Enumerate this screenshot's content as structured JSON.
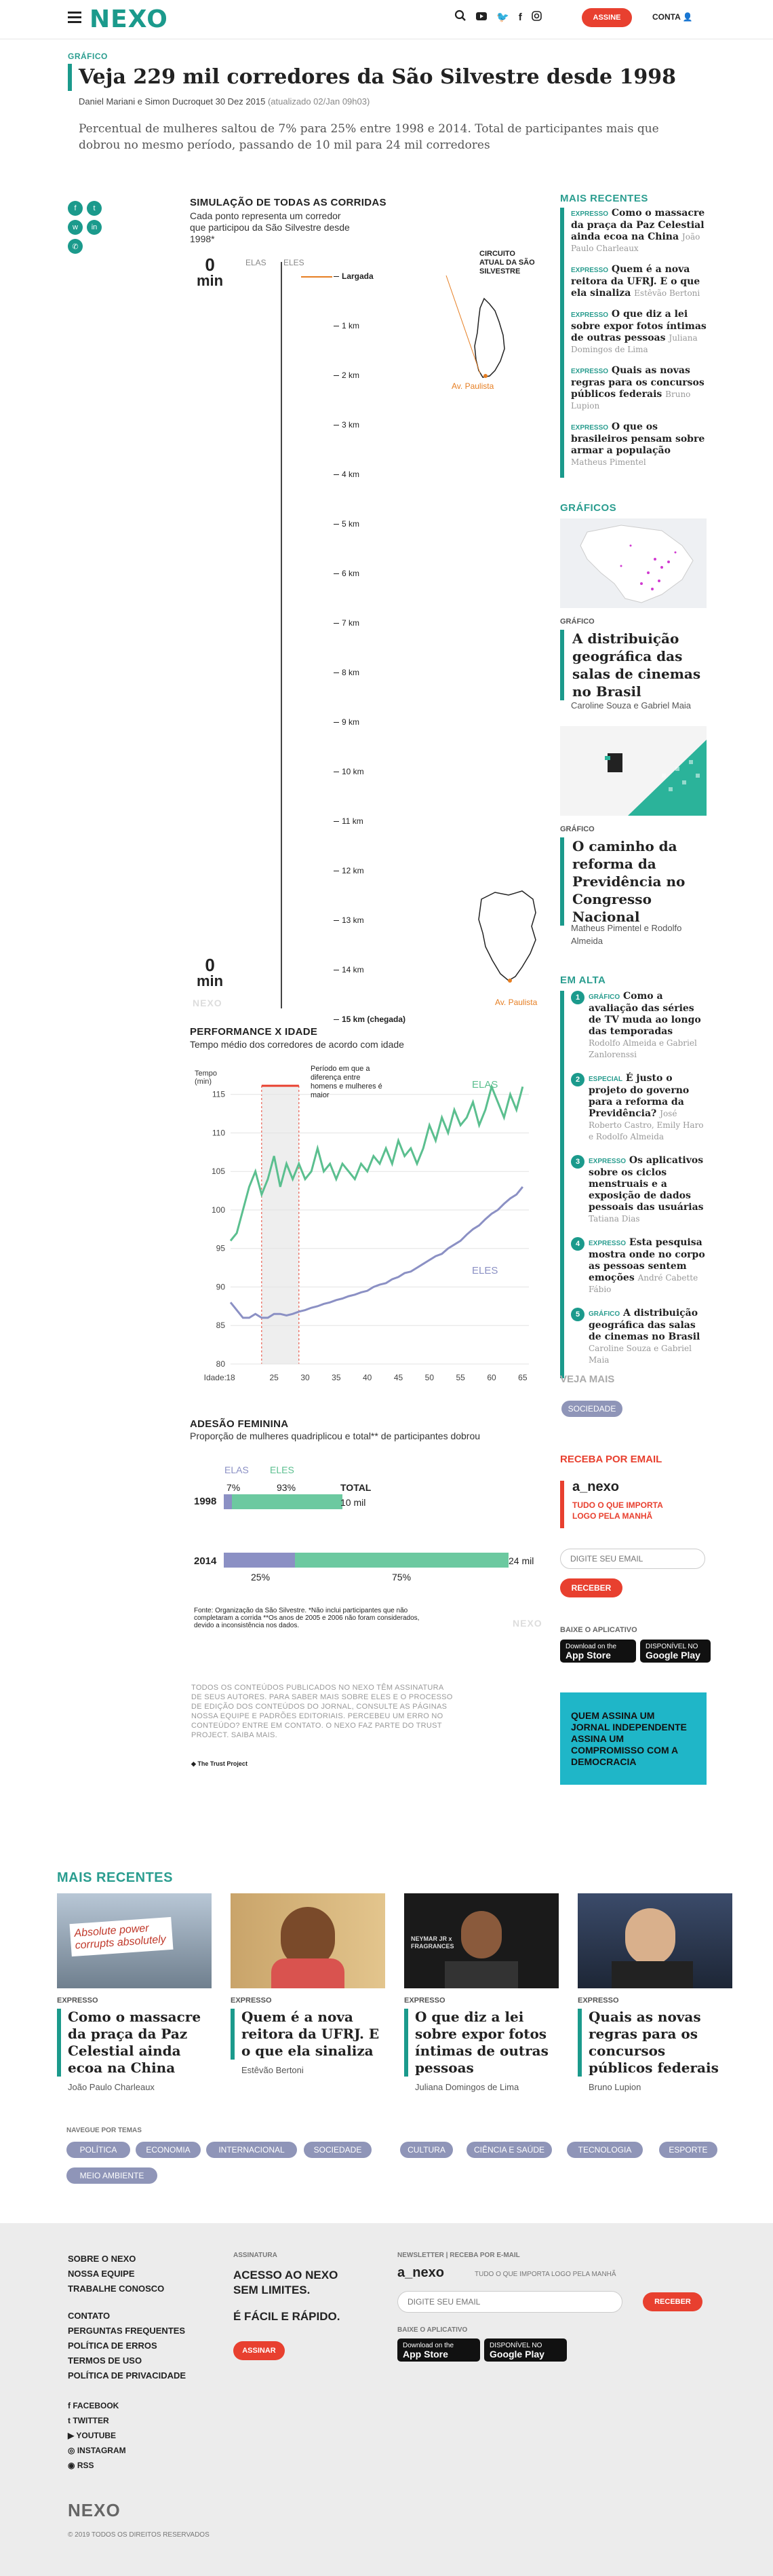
{
  "header": {
    "logo": "NEXO",
    "subscribe_label": "ASSINE",
    "account_label": "CONTA"
  },
  "article": {
    "kicker": "GRÁFICO",
    "title": "Veja 229 mil corredores da São Silvestre desde 1998",
    "authors": "Daniel Mariani e Simon Ducroquet",
    "date": "30 Dez 2015",
    "updated": "(atualizado 02/Jan 09h03)",
    "lead": "Percentual de mulheres saltou de 7% para 25% entre 1998 e 2014. Total de participantes mais que dobrou no mesmo período, passando de 10 mil para 24 mil corredores"
  },
  "simulation": {
    "title": "SIMULAÇÃO DE TODAS AS CORRIDAS",
    "subtitle": "Cada ponto representa um corredor que participou da São Silvestre desde 1998*",
    "time_top": "0",
    "time_top_unit": "min",
    "time_bottom": "0",
    "time_bottom_unit": "min",
    "elas": "ELAS",
    "eles": "ELES",
    "watermark": "NEXO",
    "km_labels": [
      "Largada",
      "1 km",
      "2 km",
      "3 km",
      "4 km",
      "5 km",
      "6 km",
      "7 km",
      "8 km",
      "9 km",
      "10 km",
      "11 km",
      "12 km",
      "13 km",
      "14 km",
      "15 km (chegada)"
    ],
    "circuit_label": "CIRCUITO ATUAL DA SÃO SILVESTRE",
    "paulista_label": "Av. Paulista",
    "paulista_label_2": "Av. Paulista"
  },
  "performance": {
    "title": "PERFORMANCE X IDADE",
    "subtitle": "Tempo médio dos corredores de acordo com idade",
    "ylabel": "Tempo (min)",
    "xlabel": "Idade:",
    "annotation": "Período em que a diferença entre homens e mulheres é maior",
    "elas": "ELAS",
    "eles": "ELES"
  },
  "chart_data": {
    "type": "line",
    "title": "PERFORMANCE X IDADE",
    "ylabel": "Tempo (min)",
    "xlabel": "Idade:",
    "x_ticks": [
      18,
      25,
      30,
      35,
      40,
      45,
      50,
      55,
      60,
      65
    ],
    "y_ticks": [
      80,
      85,
      90,
      95,
      100,
      105,
      110,
      115
    ],
    "ylim": [
      80,
      117
    ],
    "xlim": [
      18,
      66
    ],
    "highlight_range": [
      23,
      29
    ],
    "series": [
      {
        "name": "ELAS",
        "color": "#5bbf8f",
        "x": [
          18,
          19,
          20,
          21,
          22,
          23,
          24,
          25,
          26,
          27,
          28,
          29,
          30,
          31,
          32,
          33,
          34,
          35,
          36,
          37,
          38,
          39,
          40,
          41,
          42,
          43,
          44,
          45,
          46,
          47,
          48,
          49,
          50,
          51,
          52,
          53,
          54,
          55,
          56,
          57,
          58,
          59,
          60,
          61,
          62,
          63,
          64,
          65
        ],
        "values": [
          96,
          97,
          100,
          103,
          105,
          102,
          104,
          107,
          103,
          106,
          104,
          106,
          104,
          105,
          108,
          105,
          106,
          104,
          106,
          105,
          104,
          106,
          105,
          107,
          106,
          108,
          106,
          109,
          107,
          108,
          106,
          108,
          111,
          109,
          112,
          110,
          113,
          111,
          112,
          114,
          111,
          113,
          116,
          114,
          112,
          115,
          113,
          116
        ]
      },
      {
        "name": "ELES",
        "color": "#8b90c4",
        "x": [
          18,
          19,
          20,
          21,
          22,
          23,
          24,
          25,
          26,
          27,
          28,
          29,
          30,
          31,
          32,
          33,
          34,
          35,
          36,
          37,
          38,
          39,
          40,
          41,
          42,
          43,
          44,
          45,
          46,
          47,
          48,
          49,
          50,
          51,
          52,
          53,
          54,
          55,
          56,
          57,
          58,
          59,
          60,
          61,
          62,
          63,
          64,
          65
        ],
        "values": [
          88,
          87,
          86,
          86,
          86.5,
          86,
          86,
          86.5,
          86.5,
          86.3,
          86.5,
          86.8,
          87,
          87.3,
          87.5,
          87.8,
          88,
          88.3,
          88.5,
          88.8,
          89,
          89.3,
          89.5,
          90,
          90.3,
          90.5,
          91,
          91.3,
          91.8,
          92,
          92.5,
          93,
          93.5,
          94,
          94.3,
          95,
          95.5,
          96,
          96.8,
          97.5,
          98,
          98.8,
          99.5,
          100,
          100.8,
          101.5,
          102,
          103
        ]
      }
    ]
  },
  "adesao": {
    "title": "ADESÃO FEMININA",
    "subtitle": "Proporção de mulheres quadriplicou e total** de participantes dobrou",
    "elas": "ELAS",
    "eles": "ELES",
    "total": "TOTAL",
    "rows": [
      {
        "year": "1998",
        "women_pct": "7%",
        "men_pct": "93%",
        "total": "10 mil",
        "women": 0.07,
        "total_k": 10
      },
      {
        "year": "2014",
        "women_pct": "25%",
        "men_pct": "75%",
        "total": "24 mil",
        "women": 0.25,
        "total_k": 24
      }
    ],
    "source": "Fonte: Organização da São Silvestre. *Não inclui participantes que não completaram a corrida **Os anos de 2005 e 2006 não foram considerados, devido a inconsistência nos dados.",
    "watermark": "NEXO"
  },
  "disclaimer": {
    "text": "TODOS OS CONTEÚDOS PUBLICADOS NO NEXO TÊM ASSINATURA DE SEUS AUTORES. PARA SABER MAIS SOBRE ELES E O PROCESSO DE EDIÇÃO DOS CONTEÚDOS DO JORNAL, CONSULTE AS PÁGINAS NOSSA EQUIPE E PADRÕES EDITORIAIS. PERCEBEU UM ERRO NO CONTEÚDO? ENTRE EM CONTATO. O NEXO FAZ PARTE DO TRUST PROJECT. SAIBA MAIS.",
    "trust": "The Trust Project"
  },
  "sidebar": {
    "recent_title": "MAIS RECENTES",
    "recent": [
      {
        "tag": "EXPRESSO",
        "title": "Como o massacre da praça da Paz Celestial ainda ecoa na China",
        "author": "João Paulo Charleaux"
      },
      {
        "tag": "EXPRESSO",
        "title": "Quem é a nova reitora da UFRJ. E o que ela sinaliza",
        "author": "Estêvão Bertoni"
      },
      {
        "tag": "EXPRESSO",
        "title": "O que diz a lei sobre expor fotos íntimas de outras pessoas",
        "author": "Juliana Domingos de Lima"
      },
      {
        "tag": "EXPRESSO",
        "title": "Quais as novas regras para os concursos públicos federais",
        "author": "Bruno Lupion"
      },
      {
        "tag": "EXPRESSO",
        "title": "O que os brasileiros pensam sobre armar a população",
        "author": "Matheus Pimentel"
      }
    ],
    "graphics_title": "GRÁFICOS",
    "graphics": [
      {
        "label": "GRÁFICO",
        "title": "A distribuição geográfica das salas de cinemas no Brasil",
        "author": "Caroline Souza e Gabriel Maia"
      },
      {
        "label": "GRÁFICO",
        "title": "O caminho da reforma da Previdência no Congresso Nacional",
        "author": "Matheus Pimentel e Rodolfo Almeida"
      }
    ],
    "trending_title": "EM ALTA",
    "trending": [
      {
        "n": "1",
        "tag": "GRÁFICO",
        "title": "Como a avaliação das séries de TV muda ao longo das temporadas",
        "author": "Rodolfo Almeida e Gabriel Zanlorenssi"
      },
      {
        "n": "2",
        "tag": "ESPECIAL",
        "title": "É justo o projeto do governo para a reforma da Previdência?",
        "author": "José Roberto Castro, Emily Haro e Rodolfo Almeida"
      },
      {
        "n": "3",
        "tag": "EXPRESSO",
        "title": "Os aplicativos sobre os ciclos menstruais e a exposição de dados pessoais das usuárias",
        "author": "Tatiana Dias"
      },
      {
        "n": "4",
        "tag": "EXPRESSO",
        "title": "Esta pesquisa mostra onde no corpo as pessoas sentem emoções",
        "author": "André Cabette Fábio"
      },
      {
        "n": "5",
        "tag": "GRÁFICO",
        "title": "A distribuição geográfica das salas de cinemas no Brasil",
        "author": "Caroline Souza e Gabriel Maia"
      }
    ],
    "see_more_title": "VEJA MAIS",
    "see_more_tag": "SOCIEDADE",
    "newsletter_title": "RECEBA POR EMAIL",
    "newsletter_name": "a_nexo",
    "newsletter_desc": "TUDO O QUE IMPORTA LOGO PELA MANHÃ",
    "email_placeholder": "DIGITE SEU EMAIL",
    "receive_label": "RECEBER",
    "app_title": "BAIXE O APLICATIVO",
    "app_store": "App Store",
    "app_store_small": "Download on the",
    "google_play": "Google Play",
    "google_play_small": "DISPONÍVEL NO",
    "promo": "QUEM ASSINA UM JORNAL INDEPENDENTE ASSINA UM COMPROMISSO COM A DEMOCRACIA"
  },
  "bottom_recent": {
    "title": "MAIS RECENTES",
    "items": [
      {
        "tag": "EXPRESSO",
        "title": "Como o massacre da praça da Paz Celestial ainda ecoa na China",
        "author": "João Paulo Charleaux",
        "img_text": "Absolute power corrupts absolutely"
      },
      {
        "tag": "EXPRESSO",
        "title": "Quem é a nova reitora da UFRJ. E o que ela sinaliza",
        "author": "Estêvão Bertoni"
      },
      {
        "tag": "EXPRESSO",
        "title": "O que diz a lei sobre expor fotos íntimas de outras pessoas",
        "author": "Juliana Domingos de Lima",
        "img_text": "NEYMAR JR x FRAGRANCES"
      },
      {
        "tag": "EXPRESSO",
        "title": "Quais as novas regras para os concursos públicos federais",
        "author": "Bruno Lupion"
      }
    ]
  },
  "topics": {
    "title": "NAVEGUE POR TEMAS",
    "items": [
      "POLÍTICA",
      "ECONOMIA",
      "INTERNACIONAL",
      "SOCIEDADE",
      "CULTURA",
      "CIÊNCIA E SAÚDE",
      "TECNOLOGIA",
      "ESPORTE",
      "MEIO AMBIENTE"
    ]
  },
  "footer": {
    "links1": [
      "SOBRE O NEXO",
      "NOSSA EQUIPE",
      "TRABALHE CONOSCO"
    ],
    "links2": [
      "CONTATO",
      "PERGUNTAS FREQUENTES",
      "POLÍTICA DE ERROS",
      "TERMOS DE USO",
      "POLÍTICA DE PRIVACIDADE"
    ],
    "social": [
      "FACEBOOK",
      "TWITTER",
      "YOUTUBE",
      "INSTAGRAM",
      "RSS"
    ],
    "sign_label": "ASSINATURA",
    "sign_line1": "ACESSO AO NEXO",
    "sign_line2": "SEM LIMITES.",
    "sign_line3": "É FÁCIL E RÁPIDO.",
    "sign_button": "ASSINAR",
    "nl_label": "NEWSLETTER | RECEBA POR E-MAIL",
    "nl_name": "a_nexo",
    "nl_desc": "TUDO O QUE IMPORTA LOGO PELA MANHÃ",
    "email_placeholder": "DIGITE SEU EMAIL",
    "receive_label": "RECEBER",
    "app_label": "BAIXE O APLICATIVO",
    "app_store": "App Store",
    "app_store_small": "Download on the",
    "google_play": "Google Play",
    "google_play_small": "DISPONÍVEL NO",
    "logo": "NEXO",
    "copyright": "© 2019 TODOS OS DIREITOS RESERVADOS"
  },
  "colors": {
    "brand": "#1b9a8c",
    "accent": "#e8402f",
    "women": "#5bbf8f",
    "men": "#8b90c4",
    "orange": "#e67e22"
  }
}
